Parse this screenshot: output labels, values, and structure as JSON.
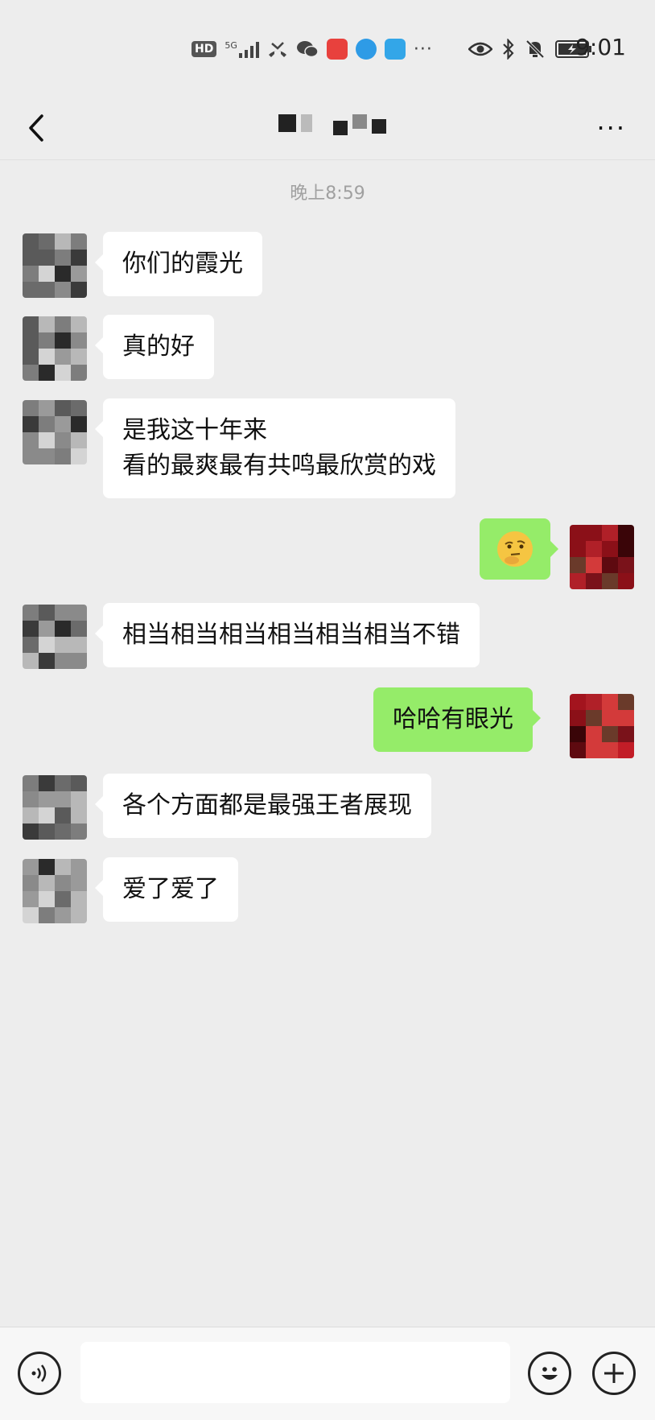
{
  "status_bar": {
    "time": "9:01",
    "network": "5G",
    "hd_label": "HD",
    "icons_left": [
      "hd-icon",
      "signal-icon",
      "missed-call-icon",
      "wechat-icon",
      "huawei-app-icon",
      "blue-app-icon",
      "browser-app-icon",
      "more-dots-icon"
    ],
    "icons_right": [
      "eye-icon",
      "bluetooth-icon",
      "mute-icon",
      "battery-icon"
    ],
    "more": "···"
  },
  "header": {
    "contact_name": "",
    "more_label": "···"
  },
  "chat": {
    "timestamp": "晚上8:59",
    "messages": [
      {
        "side": "in",
        "text": "你们的霞光"
      },
      {
        "side": "in",
        "text": "真的好"
      },
      {
        "side": "in",
        "line1": "是我这十年来",
        "line2": "看的最爽最有共鸣最欣赏的戏"
      },
      {
        "side": "out",
        "emoji": "thinking-face-emoji"
      },
      {
        "side": "in",
        "text": "相当相当相当相当相当相当不错"
      },
      {
        "side": "out",
        "text": "哈哈有眼光"
      },
      {
        "side": "in",
        "text": "各个方面都是最强王者展现"
      },
      {
        "side": "in",
        "text": "爱了爱了"
      }
    ]
  },
  "input_bar": {
    "voice_icon": "voice-icon",
    "emoji_icon": "emoji-icon",
    "plus_icon": "plus-icon",
    "input_value": ""
  },
  "colors": {
    "background": "#ededed",
    "incoming_bubble": "#ffffff",
    "outgoing_bubble": "#95ec69",
    "timestamp": "#a0a0a0"
  }
}
